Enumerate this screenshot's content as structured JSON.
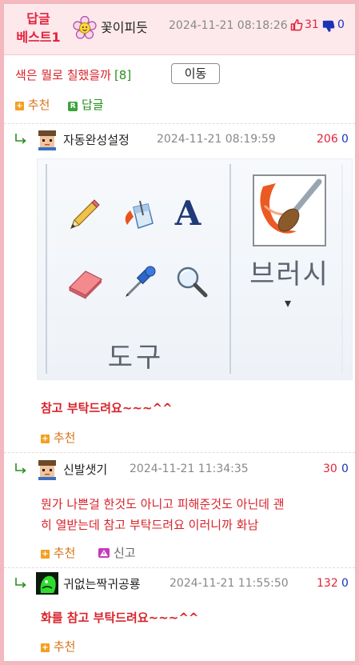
{
  "header": {
    "best_label_line1": "답글",
    "best_label_line2": "베스트1",
    "author": "꽃이피듯",
    "timestamp": "2024-11-21 08:18:26",
    "upvotes": "31",
    "downvotes": "0"
  },
  "post": {
    "title": "색은 뭘로 칠했을까",
    "reply_count": "[8]",
    "move_button": "이동"
  },
  "actions": {
    "recommend": "추천",
    "reply": "답글",
    "report": "신고"
  },
  "tool_image": {
    "tools_label": "도구",
    "brush_label": "브러시",
    "text_tool_glyph": "A",
    "dropdown_glyph": "▾"
  },
  "comments": [
    {
      "author": "자동완성설정",
      "timestamp": "2024-11-21 08:19:59",
      "upvotes": "206",
      "downvotes": "0",
      "text": "참고 부탁드려요~~~^^"
    },
    {
      "author": "신발샛기",
      "timestamp": "2024-11-21 11:34:35",
      "upvotes": "30",
      "downvotes": "0",
      "text_line1": "뭔가 나쁜걸 한것도 아니고 피해준것도 아닌데 괜",
      "text_line2": "히 열받는데 참고 부탁드려요 이러니까 화남"
    },
    {
      "author": "귀없는짝귀공룡",
      "timestamp": "2024-11-21 11:55:50",
      "upvotes": "132",
      "downvotes": "0",
      "text": "화를 참고 부탁드려요~~~^^"
    }
  ],
  "colors": {
    "accent_red": "#e2233b",
    "border_pink": "#f4b8bf",
    "header_bg": "#fde9ec",
    "downvote_blue": "#1b34b5",
    "recommend_orange": "#d9731a"
  }
}
